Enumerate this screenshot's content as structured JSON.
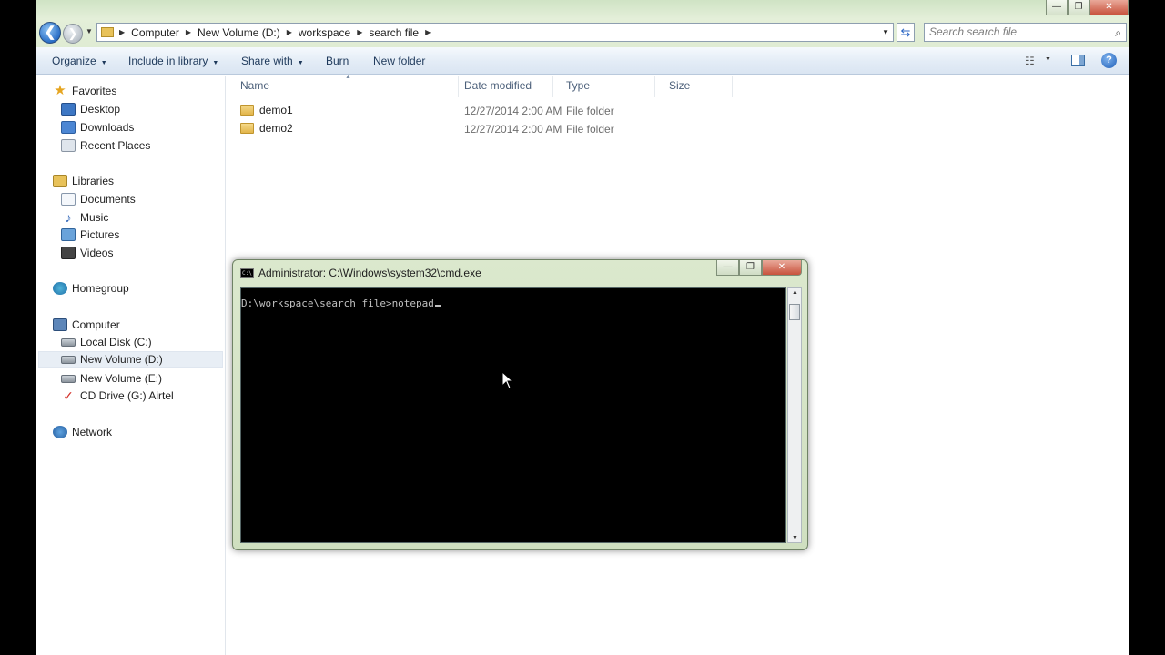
{
  "window": {
    "min_glyph": "—",
    "max_glyph": "❐",
    "close_glyph": "✕"
  },
  "address": {
    "crumbs": [
      "Computer",
      "New Volume (D:)",
      "workspace",
      "search file"
    ],
    "search_placeholder": "Search search file"
  },
  "toolbar": {
    "organize": "Organize",
    "include": "Include in library",
    "share": "Share with",
    "burn": "Burn",
    "new_folder": "New folder"
  },
  "nav": {
    "favorites": "Favorites",
    "desktop": "Desktop",
    "downloads": "Downloads",
    "recent": "Recent Places",
    "libraries": "Libraries",
    "documents": "Documents",
    "music": "Music",
    "pictures": "Pictures",
    "videos": "Videos",
    "homegroup": "Homegroup",
    "computer": "Computer",
    "local_c": "Local Disk (C:)",
    "vol_d": "New Volume (D:)",
    "vol_e": "New Volume (E:)",
    "cd_g": "CD Drive (G:) Airtel",
    "network": "Network"
  },
  "columns": {
    "name": "Name",
    "date": "Date modified",
    "type": "Type",
    "size": "Size"
  },
  "files": [
    {
      "name": "demo1",
      "date": "12/27/2014 2:00 AM",
      "type": "File folder"
    },
    {
      "name": "demo2",
      "date": "12/27/2014 2:00 AM",
      "type": "File folder"
    }
  ],
  "cmd": {
    "title": "Administrator: C:\\Windows\\system32\\cmd.exe",
    "prompt": "D:\\workspace\\search file>notepad"
  },
  "colors": {
    "titlebar": "#dfecd3",
    "toolbar": "#dae5f2",
    "console_bg": "#000000",
    "console_text": "#c0c0c0"
  }
}
